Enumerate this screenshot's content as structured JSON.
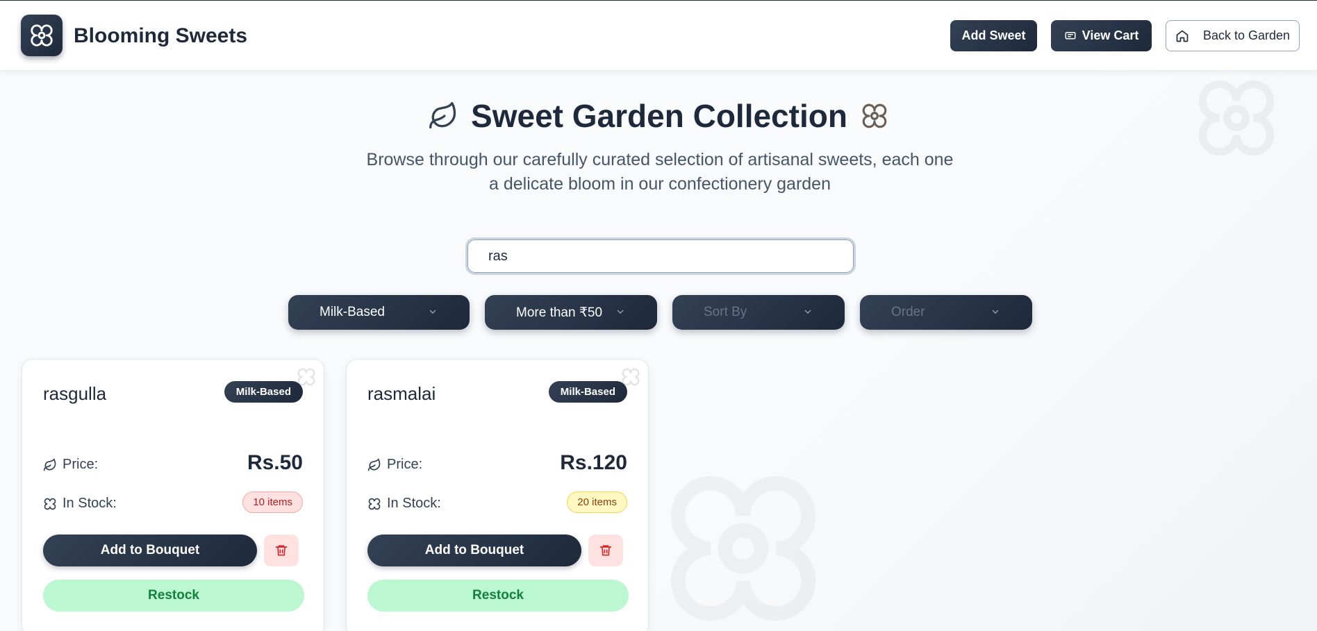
{
  "app": {
    "brand": "Blooming Sweets"
  },
  "header": {
    "add_sweet": "Add Sweet",
    "view_cart": "View Cart",
    "back_to_garden": "Back to Garden"
  },
  "hero": {
    "title": "Sweet Garden Collection",
    "subtitle": "Browse through our carefully curated selection of artisanal sweets, each one a delicate bloom in our confectionery garden"
  },
  "search": {
    "value": "ras"
  },
  "filters": {
    "category": "Milk-Based",
    "price": "More than ₹50",
    "sort_by": "Sort By",
    "order": "Order"
  },
  "labels": {
    "price": "Price:",
    "in_stock": "In Stock:",
    "add_to_bouquet": "Add to Bouquet",
    "restock": "Restock"
  },
  "sweets": [
    {
      "name": "rasgulla",
      "category": "Milk-Based",
      "price": "Rs.50",
      "stock": "10 items",
      "stock_level": "low"
    },
    {
      "name": "rasmalai",
      "category": "Milk-Based",
      "price": "Rs.120",
      "stock": "20 items",
      "stock_level": "medium"
    }
  ],
  "colors": {
    "primary": "#1e293b",
    "low_stock": "#fee2e2",
    "medium_stock": "#fef9c3",
    "restock": "#bbf7d0"
  },
  "icons": {
    "logo": "flower-icon",
    "cart": "cart-icon",
    "home": "home-icon",
    "leaf": "leaf-icon",
    "delete": "trash-icon",
    "dropdown": "chevron-down-icon"
  }
}
